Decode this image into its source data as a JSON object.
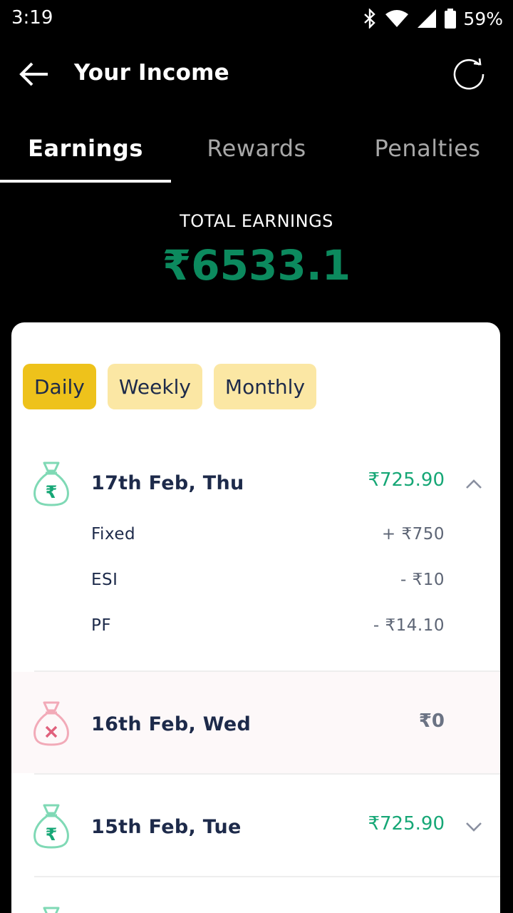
{
  "status_bar": {
    "time": "3:19",
    "battery": "59%",
    "icons": [
      "bluetooth-icon",
      "wifi-icon",
      "cell-signal-icon",
      "battery-icon"
    ]
  },
  "header": {
    "title": "Your Income",
    "back_icon": "arrow-left-icon",
    "refresh_icon": "refresh-icon"
  },
  "tabs": [
    {
      "label": "Earnings",
      "active": true
    },
    {
      "label": "Rewards",
      "active": false
    },
    {
      "label": "Penalties",
      "active": false
    }
  ],
  "total": {
    "label": "TOTAL EARNINGS",
    "value": "₹6533.1"
  },
  "filters": [
    {
      "label": "Daily",
      "active": true
    },
    {
      "label": "Weekly",
      "active": false
    },
    {
      "label": "Monthly",
      "active": false
    }
  ],
  "days": [
    {
      "date": "17th Feb, Thu",
      "amount": "₹725.90",
      "expanded": true,
      "breakdown": [
        {
          "label": "Fixed",
          "value": "+ ₹750"
        },
        {
          "label": "ESI",
          "value": "-  ₹10"
        },
        {
          "label": "PF",
          "value": "- ₹14.10"
        }
      ]
    },
    {
      "date": "16th Feb, Wed",
      "amount": "₹0",
      "expanded": false
    },
    {
      "date": "15th Feb, Tue",
      "amount": "₹725.90",
      "expanded": false
    }
  ],
  "colors": {
    "total_green": "#0c8a5e",
    "amount_green": "#16a776",
    "chip_active": "#eec21b",
    "chip_inactive": "#fbe7a4",
    "bag_green": "#7fd9b5",
    "bag_red": "#f2aab8"
  }
}
